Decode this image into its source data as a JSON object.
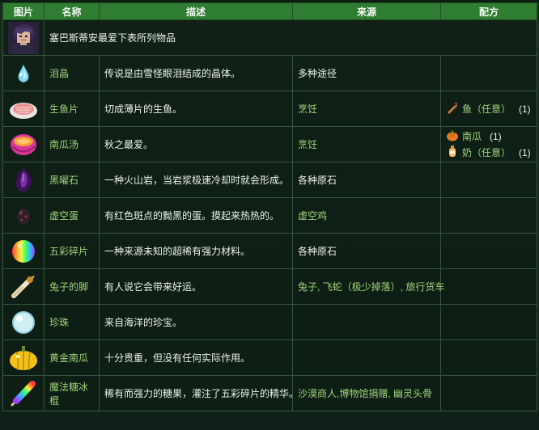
{
  "headers": {
    "image": "图片",
    "name": "名称",
    "desc": "描述",
    "source": "来源",
    "recipe": "配方"
  },
  "intro": {
    "text": "塞巴斯蒂安最爱下表所列物品",
    "avatar_icon": "sebastian-portrait-icon"
  },
  "rows": [
    {
      "icon": "frozen-tear-icon",
      "name": "泪晶",
      "desc": "传说是由雪怪眼泪结成的晶体。",
      "source": "多种途径",
      "source_link": false
    },
    {
      "icon": "sashimi-icon",
      "name": "生鱼片",
      "desc": "切成薄片的生鱼。",
      "source": "烹饪",
      "source_link": true,
      "recipe": [
        {
          "icon": "fish-icon",
          "label": "鱼（任意）",
          "qty": "(1)"
        }
      ]
    },
    {
      "icon": "pumpkin-soup-icon",
      "name": "南瓜汤",
      "desc": "秋之最爱。",
      "source": "烹饪",
      "source_link": true,
      "recipe": [
        {
          "icon": "pumpkin-icon",
          "label": "南瓜",
          "qty": "(1)"
        },
        {
          "icon": "milk-icon",
          "label": "奶（任意）",
          "qty": "(1)"
        }
      ]
    },
    {
      "icon": "obsidian-icon",
      "name": "黑曜石",
      "desc": "一种火山岩，当岩浆极速冷却时就会形成。",
      "source": "各种原石",
      "source_link": false
    },
    {
      "icon": "void-egg-icon",
      "name": "虚空蛋",
      "desc": "有红色斑点的黝黑的蛋。摸起来热热的。",
      "source": "虚空鸡",
      "source_link": true
    },
    {
      "icon": "prismatic-shard-icon",
      "name": "五彩碎片",
      "desc": "一种来源未知的超稀有强力材料。",
      "source": "各种原石",
      "source_link": false
    },
    {
      "icon": "rabbits-foot-icon",
      "name": "兔子的脚",
      "desc": "有人说它会带来好运。",
      "source": "兔子, 飞蛇（极少掉落）, 旅行货车",
      "source_link": true
    },
    {
      "icon": "pearl-icon",
      "name": "珍珠",
      "desc": "来自海洋的珍宝。",
      "source": "",
      "source_link": false
    },
    {
      "icon": "golden-pumpkin-icon",
      "name": "黄金南瓜",
      "desc": "十分贵重，但没有任何实际作用。",
      "source": "",
      "source_link": false
    },
    {
      "icon": "magic-rock-candy-icon",
      "name": "魔法糖冰棍",
      "desc": "稀有而强力的糖果，灌注了五彩碎片的精华。",
      "source": "沙漠商人,博物馆捐赠, 幽灵头骨",
      "source_link": true
    }
  ]
}
